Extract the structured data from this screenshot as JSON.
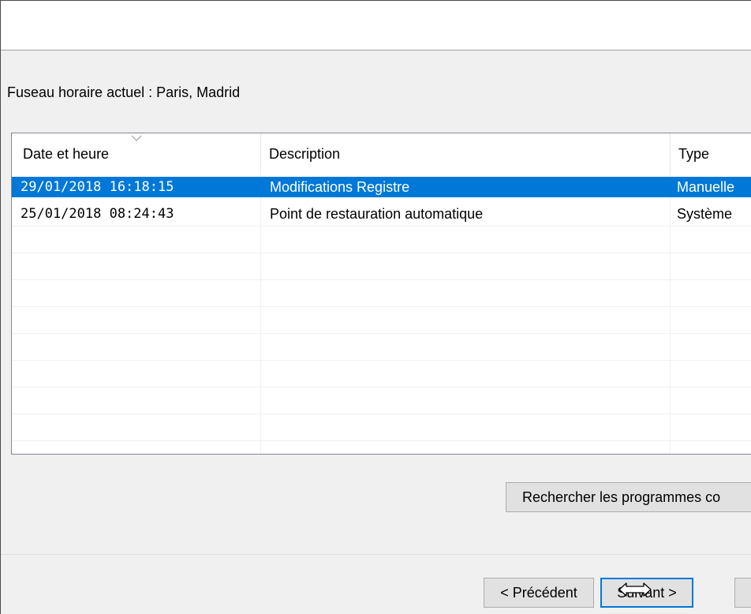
{
  "timezone_label": "Fuseau horaire actuel : Paris, Madrid",
  "restore_list": {
    "columns": [
      {
        "label": "Date et heure"
      },
      {
        "label": "Description"
      },
      {
        "label": "Type"
      }
    ],
    "sort_indicator": "chevron-down-icon",
    "rows": [
      {
        "date": "29/01/2018 16:18:15",
        "description": "Modifications Registre",
        "type": "Manuelle",
        "selected": true
      },
      {
        "date": "25/01/2018 08:24:43",
        "description": "Point de restauration automatique",
        "type": "Système",
        "selected": false
      }
    ]
  },
  "buttons": {
    "search_programs": "Rechercher les programmes co",
    "previous": "< Précédent",
    "next": "Suivant >"
  },
  "colors": {
    "selection": "#0078d7",
    "focus_border": "#0078d7"
  }
}
